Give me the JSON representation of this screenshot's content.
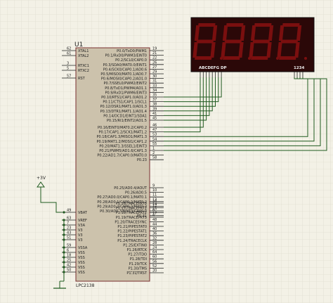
{
  "mcu": {
    "ref": "U1",
    "part": "LPC2138",
    "left_pins": [
      {
        "num": "62",
        "name": "XTAL1"
      },
      {
        "num": "61",
        "name": "XTAL2"
      },
      {
        "num": "3",
        "name": "RTXC1"
      },
      {
        "num": "5",
        "name": "RTXC2"
      },
      {
        "num": "57",
        "name": "RST"
      },
      {
        "num": "49",
        "name": "VBAT"
      },
      {
        "num": "63",
        "name": "VREF"
      },
      {
        "num": "7",
        "name": "V3A"
      },
      {
        "num": "23",
        "name": "V3"
      },
      {
        "num": "43",
        "name": "V3"
      },
      {
        "num": "51",
        "name": "V3"
      },
      {
        "num": "59",
        "name": "VSSA"
      },
      {
        "num": "6",
        "name": "VSS"
      },
      {
        "num": "18",
        "name": "VSS"
      },
      {
        "num": "25",
        "name": "VSS"
      },
      {
        "num": "42",
        "name": "VSS"
      },
      {
        "num": "50",
        "name": "VSS"
      }
    ],
    "right_pins": [
      {
        "num": "19",
        "name": "P0.0/TxD0/PWM1"
      },
      {
        "num": "21",
        "name": "P0.1/RxD0/PWM3/EINT0"
      },
      {
        "num": "22",
        "name": "P0.2/SCL0/CAP0.0"
      },
      {
        "num": "26",
        "name": "P0.3/SDA0/MAT0.0/EINT1"
      },
      {
        "num": "27",
        "name": "P0.4/SCK0/CAP0.1/AD0.6"
      },
      {
        "num": "29",
        "name": "P0.5/MISO0/MAT0.1/AD0.7"
      },
      {
        "num": "30",
        "name": "P0.6/MOSI0/CAP0.2/AD1.0"
      },
      {
        "num": "31",
        "name": "P0.7/SSEL0/PWM2/EINT2"
      },
      {
        "num": "33",
        "name": "P0.8/TxD1/PWM4/AD1.1"
      },
      {
        "num": "34",
        "name": "P0.9/RxD1/PWM6/EINT3"
      },
      {
        "num": "35",
        "name": "P0.10/RTS1/CAP1.0/AD1.2"
      },
      {
        "num": "37",
        "name": "P0.11/CTS1/CAP1.1/SCL1"
      },
      {
        "num": "38",
        "name": "P0.12/DSR1/MAT1.0/AD1.3"
      },
      {
        "num": "39",
        "name": "P0.13/DTR1/MAT1.1/AD1.4"
      },
      {
        "num": "41",
        "name": "P0.14/DCD1/EINT1/SDA1"
      },
      {
        "num": "45",
        "name": "P0.15/RI1/EINT2/AD1.5"
      },
      {
        "num": "46",
        "name": "P0.16/EINT0/MAT0.2/CAP0.2"
      },
      {
        "num": "47",
        "name": "P0.17/CAP1.2/SCK1/MAT1.2"
      },
      {
        "num": "53",
        "name": "P0.18/CAP1.3/MISO1/MAT1.3"
      },
      {
        "num": "54",
        "name": "P0.19/MAT1.2/MOSI1/CAP1.2"
      },
      {
        "num": "55",
        "name": "P0.20/MAT1.3/SSEL1/EINT3"
      },
      {
        "num": "1",
        "name": "P0.21/PWM5/AD1.6/CAP1.3"
      },
      {
        "num": "2",
        "name": "P0.22/AD1.7/CAP0.0/MAT0.0"
      },
      {
        "num": "58",
        "name": "P0.23"
      },
      {
        "num": "9",
        "name": "P0.25/AD0.4/AOUT"
      },
      {
        "num": "10",
        "name": "P0.26/AD0.5"
      },
      {
        "num": "11",
        "name": "P0.27/AD0.0/CAP0.1/MAT0.1"
      },
      {
        "num": "13",
        "name": "P0.28/AD0.1/CAP0.2/MAT0.2"
      },
      {
        "num": "14",
        "name": "P0.29/AD0.2/CAP0.3/MAT0.3"
      },
      {
        "num": "15",
        "name": "P0.30/AD0.3/EINT3/CAP0.0"
      },
      {
        "num": "17",
        "name": "P0.31"
      },
      {
        "num": "16",
        "name": "P1.16/TRACEPKT0"
      },
      {
        "num": "12",
        "name": "P1.17/TRACEPKT1"
      },
      {
        "num": "8",
        "name": "P1.18/TRACEPKT2"
      },
      {
        "num": "4",
        "name": "P1.19/TRACEPKT3"
      },
      {
        "num": "48",
        "name": "P1.20/TRACESYNC"
      },
      {
        "num": "44",
        "name": "P1.21/PIPESTAT0"
      },
      {
        "num": "40",
        "name": "P1.22/PIPESTAT1"
      },
      {
        "num": "36",
        "name": "P1.23/PIPESTAT2"
      },
      {
        "num": "32",
        "name": "P1.24/TRACECLK"
      },
      {
        "num": "28",
        "name": "P1.25/EXTIN0"
      },
      {
        "num": "24",
        "name": "P1.26/RTCK"
      },
      {
        "num": "64",
        "name": "P1.27/TDO"
      },
      {
        "num": "60",
        "name": "P1.28/TDI"
      },
      {
        "num": "56",
        "name": "P1.29/TCK"
      },
      {
        "num": "52",
        "name": "P1.30/TMS"
      },
      {
        "num": "20",
        "name": "P1.31/TRST"
      }
    ]
  },
  "display": {
    "segment_label": "ABCDEFG DP",
    "digit_label": "1234",
    "segment_color": "#7a0f0f",
    "body_color": "#2b0808"
  },
  "power": {
    "label": "+3V"
  },
  "colors": {
    "background": "#f3f1e6",
    "grid": "#d9d7c8",
    "mcu_body": "#ccc2ac",
    "mcu_border": "#7a3030",
    "wire": "#1f5a1f",
    "pin": "#222222"
  }
}
